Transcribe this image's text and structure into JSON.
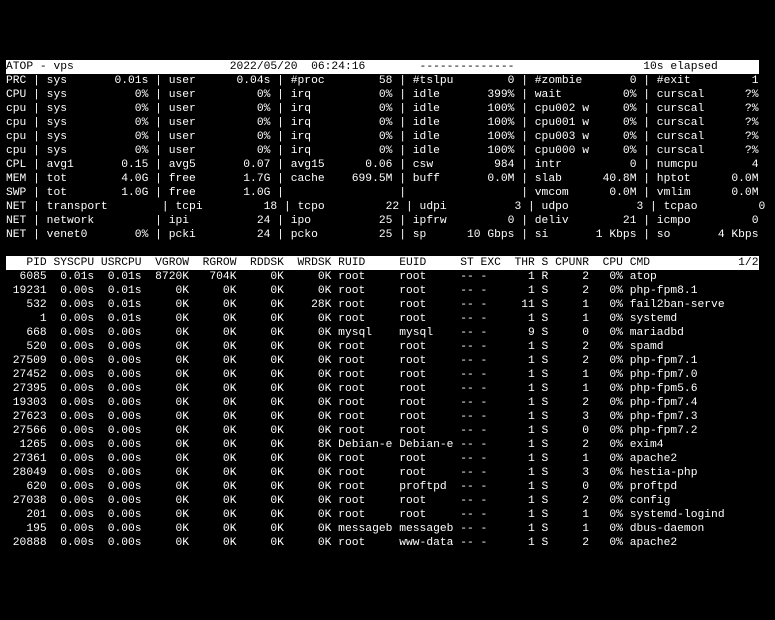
{
  "titlebar": {
    "left": "ATOP - vps",
    "datetime": "2022/05/20  06:24:16",
    "dashes": "--------------",
    "elapsed": "10s elapsed"
  },
  "hdr_rows": [
    [
      "PRC",
      "sys",
      "0.01s",
      "user",
      "0.04s",
      "#proc",
      "58",
      "#tslpu",
      "0",
      "#zombie",
      "0",
      "#exit",
      "1"
    ],
    [
      "CPU",
      "sys",
      "0%",
      "user",
      "0%",
      "irq",
      "0%",
      "idle",
      "399%",
      "wait",
      "0%",
      "curscal",
      "?%"
    ],
    [
      "cpu",
      "sys",
      "0%",
      "user",
      "0%",
      "irq",
      "0%",
      "idle",
      "100%",
      "cpu002 w",
      "0%",
      "curscal",
      "?%"
    ],
    [
      "cpu",
      "sys",
      "0%",
      "user",
      "0%",
      "irq",
      "0%",
      "idle",
      "100%",
      "cpu001 w",
      "0%",
      "curscal",
      "?%"
    ],
    [
      "cpu",
      "sys",
      "0%",
      "user",
      "0%",
      "irq",
      "0%",
      "idle",
      "100%",
      "cpu003 w",
      "0%",
      "curscal",
      "?%"
    ],
    [
      "cpu",
      "sys",
      "0%",
      "user",
      "0%",
      "irq",
      "0%",
      "idle",
      "100%",
      "cpu000 w",
      "0%",
      "curscal",
      "?%"
    ],
    [
      "CPL",
      "avg1",
      "0.15",
      "avg5",
      "0.07",
      "avg15",
      "0.06",
      "csw",
      "984",
      "intr",
      "0",
      "numcpu",
      "4"
    ],
    [
      "MEM",
      "tot",
      "4.0G",
      "free",
      "1.7G",
      "cache",
      "699.5M",
      "buff",
      "0.0M",
      "slab",
      "40.8M",
      "hptot",
      "0.0M"
    ],
    [
      "SWP",
      "tot",
      "1.0G",
      "free",
      "1.0G",
      "",
      "",
      "",
      "",
      "vmcom",
      "0.0M",
      "vmlim",
      "0.0M"
    ],
    [
      "NET",
      "transport",
      "",
      "tcpi",
      "18",
      "tcpo",
      "22",
      "udpi",
      "3",
      "udpo",
      "3",
      "tcpao",
      "0"
    ],
    [
      "NET",
      "network",
      "",
      "ipi",
      "24",
      "ipo",
      "25",
      "ipfrw",
      "0",
      "deliv",
      "21",
      "icmpo",
      "0"
    ],
    [
      "NET",
      "venet0",
      "0%",
      "pcki",
      "24",
      "pcko",
      "25",
      "sp",
      "10 Gbps",
      "si",
      "1 Kbps",
      "so",
      "4 Kbps"
    ]
  ],
  "proc_header": {
    "cols": [
      "PID",
      "SYSCPU",
      "USRCPU",
      "VGROW",
      "RGROW",
      "RDDSK",
      "WRDSK",
      "RUID",
      "EUID",
      "ST",
      "EXC",
      "THR",
      "S",
      "CPUNR",
      "CPU",
      "CMD"
    ],
    "page": "1/2"
  },
  "procs": [
    [
      "6085",
      "0.01s",
      "0.01s",
      "8720K",
      "704K",
      "0K",
      "0K",
      "root",
      "root",
      "--",
      "-",
      "1",
      "R",
      "2",
      "0%",
      "atop"
    ],
    [
      "19231",
      "0.00s",
      "0.01s",
      "0K",
      "0K",
      "0K",
      "0K",
      "root",
      "root",
      "--",
      "-",
      "1",
      "S",
      "2",
      "0%",
      "php-fpm8.1"
    ],
    [
      "532",
      "0.00s",
      "0.01s",
      "0K",
      "0K",
      "0K",
      "28K",
      "root",
      "root",
      "--",
      "-",
      "11",
      "S",
      "1",
      "0%",
      "fail2ban-serve"
    ],
    [
      "1",
      "0.00s",
      "0.01s",
      "0K",
      "0K",
      "0K",
      "0K",
      "root",
      "root",
      "--",
      "-",
      "1",
      "S",
      "1",
      "0%",
      "systemd"
    ],
    [
      "668",
      "0.00s",
      "0.00s",
      "0K",
      "0K",
      "0K",
      "0K",
      "mysql",
      "mysql",
      "--",
      "-",
      "9",
      "S",
      "0",
      "0%",
      "mariadbd"
    ],
    [
      "520",
      "0.00s",
      "0.00s",
      "0K",
      "0K",
      "0K",
      "0K",
      "root",
      "root",
      "--",
      "-",
      "1",
      "S",
      "2",
      "0%",
      "spamd"
    ],
    [
      "27509",
      "0.00s",
      "0.00s",
      "0K",
      "0K",
      "0K",
      "0K",
      "root",
      "root",
      "--",
      "-",
      "1",
      "S",
      "2",
      "0%",
      "php-fpm7.1"
    ],
    [
      "27452",
      "0.00s",
      "0.00s",
      "0K",
      "0K",
      "0K",
      "0K",
      "root",
      "root",
      "--",
      "-",
      "1",
      "S",
      "1",
      "0%",
      "php-fpm7.0"
    ],
    [
      "27395",
      "0.00s",
      "0.00s",
      "0K",
      "0K",
      "0K",
      "0K",
      "root",
      "root",
      "--",
      "-",
      "1",
      "S",
      "1",
      "0%",
      "php-fpm5.6"
    ],
    [
      "19303",
      "0.00s",
      "0.00s",
      "0K",
      "0K",
      "0K",
      "0K",
      "root",
      "root",
      "--",
      "-",
      "1",
      "S",
      "2",
      "0%",
      "php-fpm7.4"
    ],
    [
      "27623",
      "0.00s",
      "0.00s",
      "0K",
      "0K",
      "0K",
      "0K",
      "root",
      "root",
      "--",
      "-",
      "1",
      "S",
      "3",
      "0%",
      "php-fpm7.3"
    ],
    [
      "27566",
      "0.00s",
      "0.00s",
      "0K",
      "0K",
      "0K",
      "0K",
      "root",
      "root",
      "--",
      "-",
      "1",
      "S",
      "0",
      "0%",
      "php-fpm7.2"
    ],
    [
      "1265",
      "0.00s",
      "0.00s",
      "0K",
      "0K",
      "0K",
      "8K",
      "Debian-e",
      "Debian-e",
      "--",
      "-",
      "1",
      "S",
      "2",
      "0%",
      "exim4"
    ],
    [
      "27361",
      "0.00s",
      "0.00s",
      "0K",
      "0K",
      "0K",
      "0K",
      "root",
      "root",
      "--",
      "-",
      "1",
      "S",
      "1",
      "0%",
      "apache2"
    ],
    [
      "28049",
      "0.00s",
      "0.00s",
      "0K",
      "0K",
      "0K",
      "0K",
      "root",
      "root",
      "--",
      "-",
      "1",
      "S",
      "3",
      "0%",
      "hestia-php"
    ],
    [
      "620",
      "0.00s",
      "0.00s",
      "0K",
      "0K",
      "0K",
      "0K",
      "root",
      "proftpd",
      "--",
      "-",
      "1",
      "S",
      "0",
      "0%",
      "proftpd"
    ],
    [
      "27038",
      "0.00s",
      "0.00s",
      "0K",
      "0K",
      "0K",
      "0K",
      "root",
      "root",
      "--",
      "-",
      "1",
      "S",
      "2",
      "0%",
      "config"
    ],
    [
      "201",
      "0.00s",
      "0.00s",
      "0K",
      "0K",
      "0K",
      "0K",
      "root",
      "root",
      "--",
      "-",
      "1",
      "S",
      "1",
      "0%",
      "systemd-logind"
    ],
    [
      "195",
      "0.00s",
      "0.00s",
      "0K",
      "0K",
      "0K",
      "0K",
      "messageb",
      "messageb",
      "--",
      "-",
      "1",
      "S",
      "1",
      "0%",
      "dbus-daemon"
    ],
    [
      "20888",
      "0.00s",
      "0.00s",
      "0K",
      "0K",
      "0K",
      "0K",
      "root",
      "www-data",
      "--",
      "-",
      "1",
      "S",
      "2",
      "0%",
      "apache2"
    ]
  ]
}
